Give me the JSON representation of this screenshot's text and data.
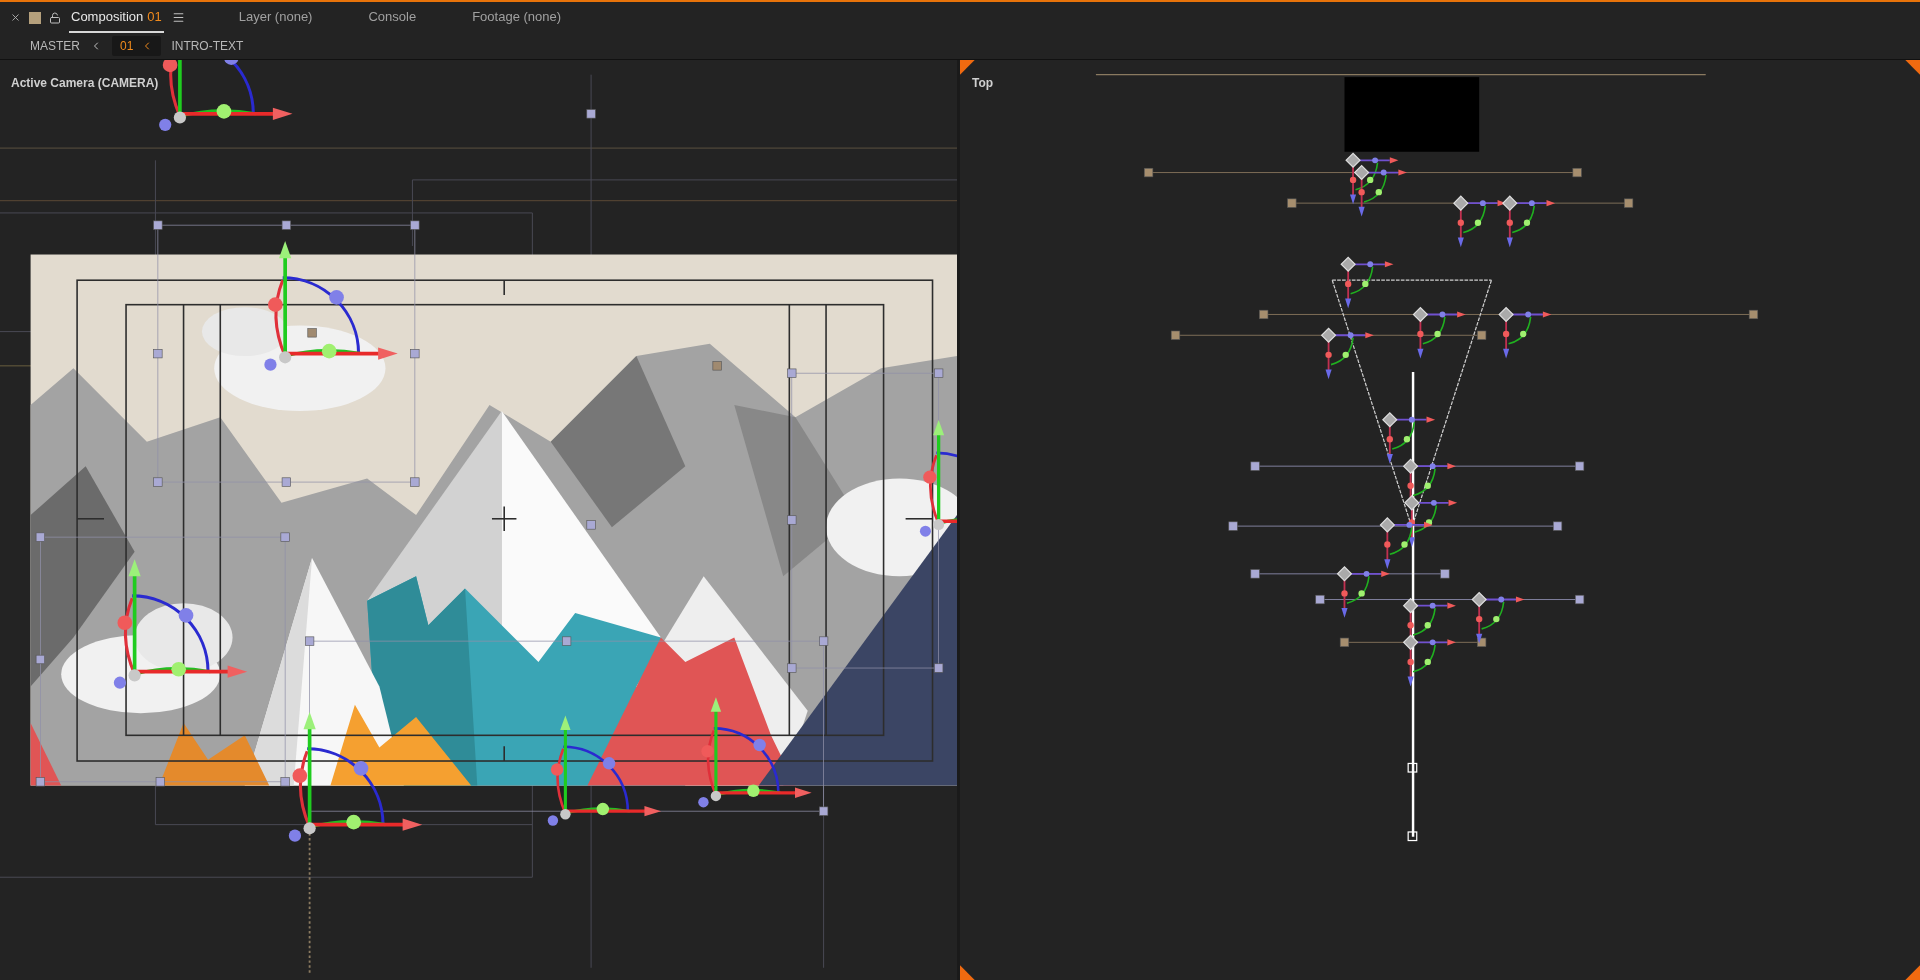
{
  "tabs": [
    {
      "label": "Composition",
      "number": "01",
      "selected": true
    },
    {
      "label": "Layer (none)",
      "selected": false
    },
    {
      "label": "Console",
      "selected": false
    },
    {
      "label": "Footage (none)",
      "selected": false
    }
  ],
  "breadcrumb": [
    {
      "label": "MASTER",
      "selected": false
    },
    {
      "label": "01",
      "selected": true
    },
    {
      "label": "INTRO-TEXT",
      "selected": false
    }
  ],
  "viewports": [
    {
      "label": "Active Camera (CAMERA)",
      "kind": "camera"
    },
    {
      "label": "Top",
      "kind": "top"
    }
  ]
}
